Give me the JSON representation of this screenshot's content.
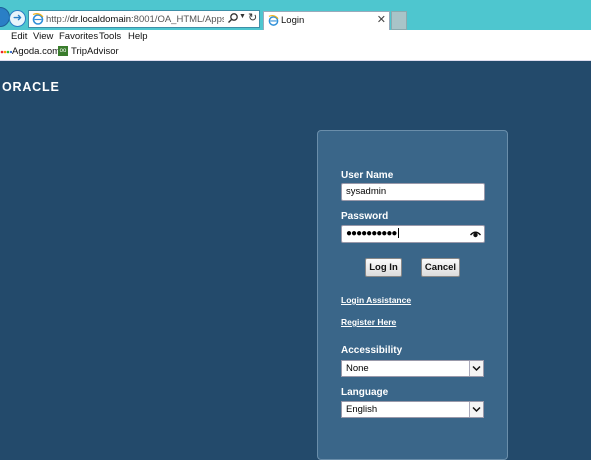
{
  "browser": {
    "address": {
      "url_prefix": "http://",
      "url_host": "dr.localdomain",
      "url_rest": ":8001/OA_HTML/AppsLocalLogi"
    },
    "tab": {
      "title": "Login"
    },
    "menu": [
      "Edit",
      "View",
      "Favorites",
      "Tools",
      "Help"
    ],
    "favorites": [
      "Agoda.com",
      "TripAdvisor"
    ]
  },
  "page": {
    "logo_text": "ORACLE",
    "login": {
      "username_label": "User Name",
      "username_value": "sysadmin",
      "password_label": "Password",
      "password_masked": "●●●●●●●●●●",
      "login_button": "Log In",
      "cancel_button": "Cancel",
      "login_assistance_link": "Login Assistance",
      "register_link": "Register Here",
      "accessibility_label": "Accessibility",
      "accessibility_value": "None",
      "language_label": "Language",
      "language_value": "English"
    }
  }
}
